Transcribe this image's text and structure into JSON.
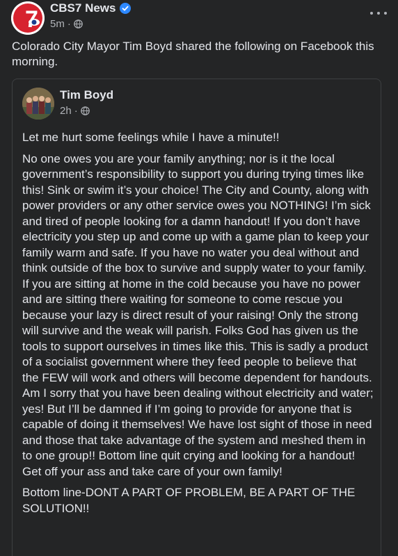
{
  "page": {
    "name": "CBS7 News",
    "logo_text": "7",
    "timestamp": "5m",
    "visibility_icon": "globe-icon"
  },
  "caption": "Colorado City Mayor Tim Boyd shared the following on Facebook this morning.",
  "shared_post": {
    "author": "Tim Boyd",
    "timestamp": "2h",
    "visibility_icon": "globe-icon",
    "paragraphs": [
      "Let me hurt some feelings while I have a minute!!",
      "No one owes you are your family anything; nor is it the local government’s responsibility to support you during trying times like this! Sink or swim it’s your choice!  The City and County, along with power providers or any other service owes you NOTHING!  I’m sick and tired of people looking for a damn handout!  If you don’t have electricity you step up and come up with a game plan to keep your family warm and safe. If you have no water you deal without and think outside of the box to survive and supply water to your family. If you are sitting at home in the cold because you have no power and are sitting there waiting for someone to come rescue you because your lazy is direct result of your raising!  Only the strong will survive and the weak will parish. Folks God has given us the tools to support ourselves in times like this. This is sadly a product of a socialist government where they feed people to believe that the FEW will work and others will become dependent for handouts. Am I sorry that you have been dealing without electricity and water; yes! But I’ll be damned if I’m going to provide for anyone that is capable of doing it themselves!  We have lost sight of those in need and those that take advantage of the system and meshed them in to one group!! Bottom line quit crying and looking for a handout! Get off your ass and take care of your own family!",
      "Bottom line-DONT A PART OF PROBLEM, BE A PART OF THE SOLUTION!!"
    ]
  },
  "colors": {
    "background": "#242526",
    "text": "#e4e6eb",
    "secondary_text": "#b0b3b8",
    "verified_blue": "#2d88ff",
    "brand_red": "#d7232f"
  }
}
